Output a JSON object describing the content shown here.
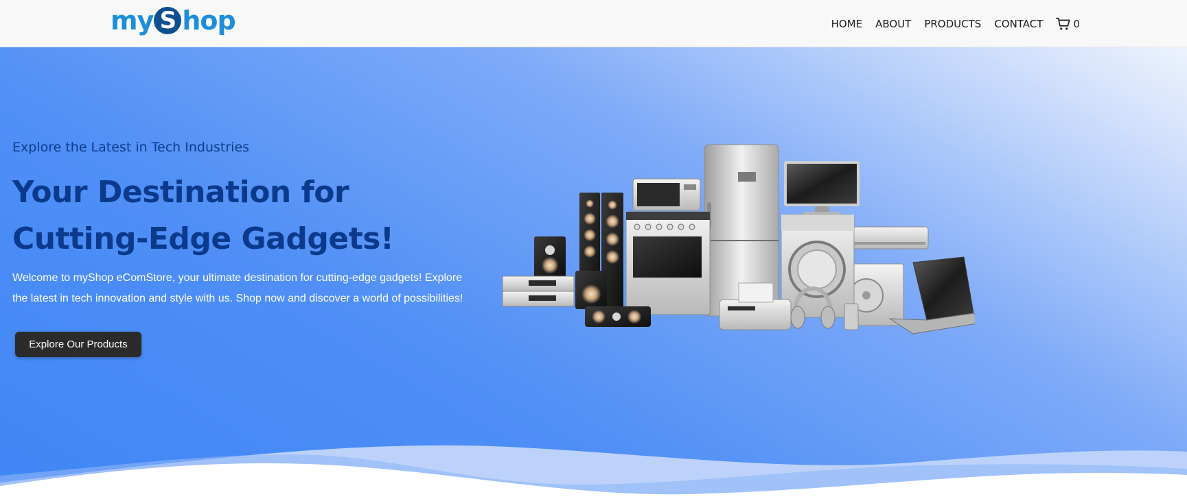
{
  "brand": {
    "logo_pre": "my",
    "logo_s": "S",
    "logo_post": "hop"
  },
  "nav": {
    "items": [
      "HOME",
      "ABOUT",
      "PRODUCTS",
      "CONTACT"
    ],
    "cart_count": "0"
  },
  "hero": {
    "subtitle": "Explore the Latest in Tech Industries",
    "headline": "Your Destination for Cutting-Edge Gadgets!",
    "description": "Welcome to myShop eComStore, your ultimate destination for cutting-edge gadgets! Explore the latest in tech innovation and style with us. Shop now and discover a world of possibilities!",
    "cta_label": "Explore Our Products"
  },
  "colors": {
    "brand_blue": "#1c8fd8",
    "logo_circle": "#0e4f8f",
    "headline": "#0b3a8c",
    "hero_gradient_start": "#3f86f5",
    "hero_gradient_end": "#eef3fd",
    "cta_bg": "#2b2b2b"
  },
  "icons": [
    "cart-icon"
  ]
}
